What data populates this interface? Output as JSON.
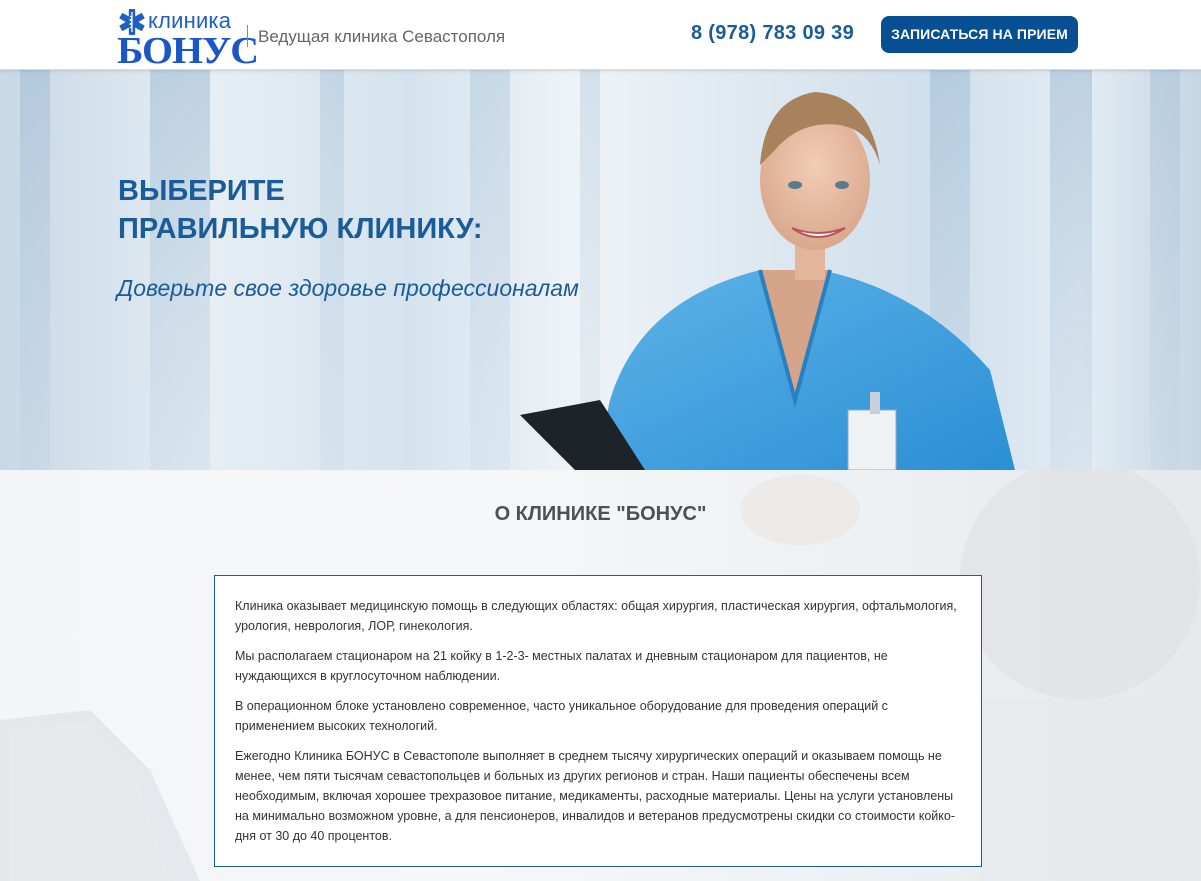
{
  "header": {
    "logo_small": "клиника",
    "logo_big": "БОНУС",
    "tagline": "Ведущая клиника Севастополя",
    "phone": "8 (978) 783 09 39",
    "cta_label": "ЗАПИСАТЬСЯ НА ПРИЕМ"
  },
  "hero": {
    "title_line1": "ВЫБЕРИТЕ",
    "title_line2": "ПРАВИЛЬНУЮ КЛИНИКУ:",
    "subtitle": "Доверьте свое здоровье профессионалам"
  },
  "about": {
    "title": "О КЛИНИКЕ \"БОНУС\"",
    "paragraphs": [
      "Клиника оказывает медицинскую помощь в следующих областях: общая хирургия, пластическая хирургия, офтальмология, урология, неврология, ЛОР, гинекология.",
      "Мы располагаем стационаром на 21 койку в 1-2-3- местных палатах и дневным стационаром для пациентов, не нуждающихся в круглосуточном наблюдении.",
      "В операционном блоке установлено современное, часто уникальное оборудование для проведения операций с применением высоких технологий.",
      "Ежегодно Клиника БОНУС в Севастополе выполняет в среднем тысячу хирургических операций и оказываем помощь не менее, чем пяти тысячам севастопольцев и больных из других регионов и стран. Наши пациенты обеспечены всем необходимым, включая хорошее трехразовое питание, медикаменты, расходные материалы. Цены на услуги установлены на минимально возможном уровне, а для пенсионеров, инвалидов и ветеранов предусмотрены скидки со стоимости койко-дня от 30 до 40 процентов."
    ]
  },
  "colors": {
    "brand_blue": "#064f93",
    "heading_blue": "#1b5c98",
    "logo_blue": "#1a55c9"
  },
  "icons": {
    "logo_mark": "star-of-life-icon"
  }
}
